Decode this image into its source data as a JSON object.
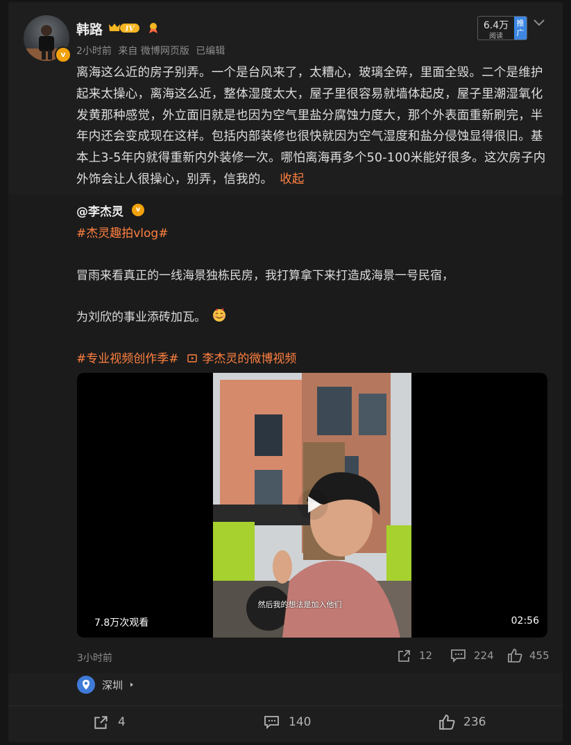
{
  "post": {
    "author": "韩路",
    "level_badge": "IV",
    "verified_mark": "v",
    "time": "2小时前",
    "source": "来自 微博网页版",
    "edited": "已编辑",
    "reads_count": "6.4万",
    "reads_label": "阅读",
    "promote_label": "推广",
    "text": "离海这么近的房子别弄。一个是台风来了，太糟心，玻璃全碎，里面全毁。二个是维护起来太操心，离海这么近，整体湿度太大，屋子里很容易就墙体起皮，屋子里潮湿氧化发黄那种感觉，外立面旧就是也因为空气里盐分腐蚀力度大，那个外表面重新刷完，半年内还会变成现在这样。包括内部装修也很快就因为空气湿度和盐分侵蚀显得很旧。基本上3-5年内就得重新内外装修一次。哪怕离海再多个50-100米能好很多。这次房子内外饰会让人很操心，别弄，信我的。",
    "collapse_label": "收起"
  },
  "repost": {
    "author": "@李杰灵",
    "hashtag1": "#杰灵趣拍vlog#",
    "line1": "冒雨来看真正的一线海景独栋民房，我打算拿下来打造成海景一号民宿，",
    "line2": "为刘欣的事业添砖加瓦。",
    "hashtag2": "#专业视频创作季#",
    "video_link": "李杰灵的微博视频",
    "video": {
      "views": "7.8万次观看",
      "duration": "02:56",
      "subtitle": "然后我的想法是加入他们"
    },
    "time": "3小时前",
    "reposts": "12",
    "comments": "224",
    "likes": "455",
    "location": "深圳"
  },
  "actions": {
    "reposts": "4",
    "comments": "140",
    "likes": "236"
  },
  "colors": {
    "accent_orange": "#ff8140",
    "verified_gold": "#f2a20d",
    "promo_blue": "#3d87e3",
    "location_blue": "#3e7ad8"
  }
}
